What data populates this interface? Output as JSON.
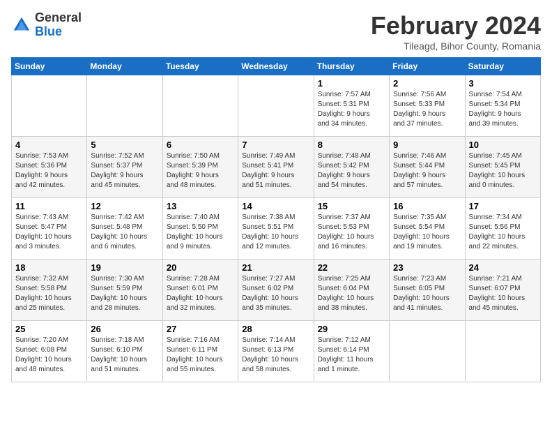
{
  "logo": {
    "general": "General",
    "blue": "Blue"
  },
  "title": "February 2024",
  "subtitle": "Tileagd, Bihor County, Romania",
  "days_header": [
    "Sunday",
    "Monday",
    "Tuesday",
    "Wednesday",
    "Thursday",
    "Friday",
    "Saturday"
  ],
  "weeks": [
    [
      {
        "day": "",
        "info": ""
      },
      {
        "day": "",
        "info": ""
      },
      {
        "day": "",
        "info": ""
      },
      {
        "day": "",
        "info": ""
      },
      {
        "day": "1",
        "info": "Sunrise: 7:57 AM\nSunset: 5:31 PM\nDaylight: 9 hours\nand 34 minutes."
      },
      {
        "day": "2",
        "info": "Sunrise: 7:56 AM\nSunset: 5:33 PM\nDaylight: 9 hours\nand 37 minutes."
      },
      {
        "day": "3",
        "info": "Sunrise: 7:54 AM\nSunset: 5:34 PM\nDaylight: 9 hours\nand 39 minutes."
      }
    ],
    [
      {
        "day": "4",
        "info": "Sunrise: 7:53 AM\nSunset: 5:36 PM\nDaylight: 9 hours\nand 42 minutes."
      },
      {
        "day": "5",
        "info": "Sunrise: 7:52 AM\nSunset: 5:37 PM\nDaylight: 9 hours\nand 45 minutes."
      },
      {
        "day": "6",
        "info": "Sunrise: 7:50 AM\nSunset: 5:39 PM\nDaylight: 9 hours\nand 48 minutes."
      },
      {
        "day": "7",
        "info": "Sunrise: 7:49 AM\nSunset: 5:41 PM\nDaylight: 9 hours\nand 51 minutes."
      },
      {
        "day": "8",
        "info": "Sunrise: 7:48 AM\nSunset: 5:42 PM\nDaylight: 9 hours\nand 54 minutes."
      },
      {
        "day": "9",
        "info": "Sunrise: 7:46 AM\nSunset: 5:44 PM\nDaylight: 9 hours\nand 57 minutes."
      },
      {
        "day": "10",
        "info": "Sunrise: 7:45 AM\nSunset: 5:45 PM\nDaylight: 10 hours\nand 0 minutes."
      }
    ],
    [
      {
        "day": "11",
        "info": "Sunrise: 7:43 AM\nSunset: 5:47 PM\nDaylight: 10 hours\nand 3 minutes."
      },
      {
        "day": "12",
        "info": "Sunrise: 7:42 AM\nSunset: 5:48 PM\nDaylight: 10 hours\nand 6 minutes."
      },
      {
        "day": "13",
        "info": "Sunrise: 7:40 AM\nSunset: 5:50 PM\nDaylight: 10 hours\nand 9 minutes."
      },
      {
        "day": "14",
        "info": "Sunrise: 7:38 AM\nSunset: 5:51 PM\nDaylight: 10 hours\nand 12 minutes."
      },
      {
        "day": "15",
        "info": "Sunrise: 7:37 AM\nSunset: 5:53 PM\nDaylight: 10 hours\nand 16 minutes."
      },
      {
        "day": "16",
        "info": "Sunrise: 7:35 AM\nSunset: 5:54 PM\nDaylight: 10 hours\nand 19 minutes."
      },
      {
        "day": "17",
        "info": "Sunrise: 7:34 AM\nSunset: 5:56 PM\nDaylight: 10 hours\nand 22 minutes."
      }
    ],
    [
      {
        "day": "18",
        "info": "Sunrise: 7:32 AM\nSunset: 5:58 PM\nDaylight: 10 hours\nand 25 minutes."
      },
      {
        "day": "19",
        "info": "Sunrise: 7:30 AM\nSunset: 5:59 PM\nDaylight: 10 hours\nand 28 minutes."
      },
      {
        "day": "20",
        "info": "Sunrise: 7:28 AM\nSunset: 6:01 PM\nDaylight: 10 hours\nand 32 minutes."
      },
      {
        "day": "21",
        "info": "Sunrise: 7:27 AM\nSunset: 6:02 PM\nDaylight: 10 hours\nand 35 minutes."
      },
      {
        "day": "22",
        "info": "Sunrise: 7:25 AM\nSunset: 6:04 PM\nDaylight: 10 hours\nand 38 minutes."
      },
      {
        "day": "23",
        "info": "Sunrise: 7:23 AM\nSunset: 6:05 PM\nDaylight: 10 hours\nand 41 minutes."
      },
      {
        "day": "24",
        "info": "Sunrise: 7:21 AM\nSunset: 6:07 PM\nDaylight: 10 hours\nand 45 minutes."
      }
    ],
    [
      {
        "day": "25",
        "info": "Sunrise: 7:20 AM\nSunset: 6:08 PM\nDaylight: 10 hours\nand 48 minutes."
      },
      {
        "day": "26",
        "info": "Sunrise: 7:18 AM\nSunset: 6:10 PM\nDaylight: 10 hours\nand 51 minutes."
      },
      {
        "day": "27",
        "info": "Sunrise: 7:16 AM\nSunset: 6:11 PM\nDaylight: 10 hours\nand 55 minutes."
      },
      {
        "day": "28",
        "info": "Sunrise: 7:14 AM\nSunset: 6:13 PM\nDaylight: 10 hours\nand 58 minutes."
      },
      {
        "day": "29",
        "info": "Sunrise: 7:12 AM\nSunset: 6:14 PM\nDaylight: 11 hours\nand 1 minute."
      },
      {
        "day": "",
        "info": ""
      },
      {
        "day": "",
        "info": ""
      }
    ]
  ]
}
